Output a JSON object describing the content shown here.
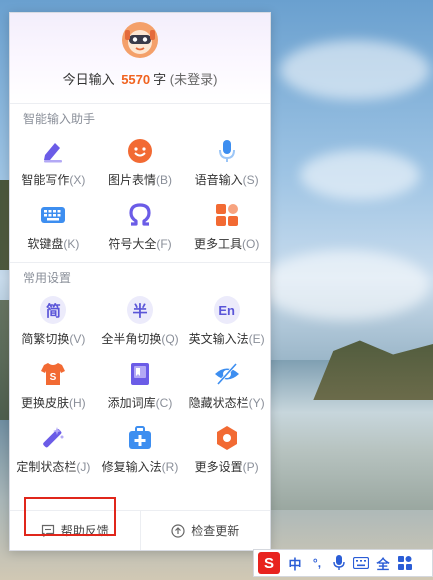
{
  "header": {
    "today_prefix": "今日输入",
    "today_count": "5570",
    "today_unit": "字",
    "login_status": "(未登录)"
  },
  "sections": [
    {
      "title": "智能输入助手",
      "items": [
        {
          "label": "智能写作",
          "key": "(X)",
          "icon": "pen-icon"
        },
        {
          "label": "图片表情",
          "key": "(B)",
          "icon": "smiley-icon"
        },
        {
          "label": "语音输入",
          "key": "(S)",
          "icon": "microphone-icon"
        },
        {
          "label": "软键盘",
          "key": "(K)",
          "icon": "keyboard-icon"
        },
        {
          "label": "符号大全",
          "key": "(F)",
          "icon": "omega-icon"
        },
        {
          "label": "更多工具",
          "key": "(O)",
          "icon": "grid-icon"
        }
      ]
    },
    {
      "title": "常用设置",
      "items": [
        {
          "label": "简繁切换",
          "key": "(V)",
          "icon": "simplified-icon",
          "glyph": "简"
        },
        {
          "label": "全半角切换",
          "key": "(Q)",
          "icon": "halfwidth-icon",
          "glyph": "半"
        },
        {
          "label": "英文输入法",
          "key": "(E)",
          "icon": "english-icon",
          "glyph": "En"
        },
        {
          "label": "更换皮肤",
          "key": "(H)",
          "icon": "skin-icon"
        },
        {
          "label": "添加词库",
          "key": "(C)",
          "icon": "dictionary-icon"
        },
        {
          "label": "隐藏状态栏",
          "key": "(Y)",
          "icon": "eye-hidden-icon"
        },
        {
          "label": "定制状态栏",
          "key": "(J)",
          "icon": "magic-wand-icon"
        },
        {
          "label": "修复输入法",
          "key": "(R)",
          "icon": "repair-kit-icon"
        },
        {
          "label": "更多设置",
          "key": "(P)",
          "icon": "gear-icon"
        }
      ]
    }
  ],
  "footer": {
    "help_label": "帮助反馈",
    "update_label": "检查更新"
  },
  "imebar": {
    "logo": "S",
    "lang": "中",
    "punct": "°,",
    "full": "全"
  },
  "colors": {
    "accent_purple": "#5a55d8",
    "orange": "#f0621f",
    "blue": "#3d8ef0",
    "highlight_red": "#e0261b"
  }
}
